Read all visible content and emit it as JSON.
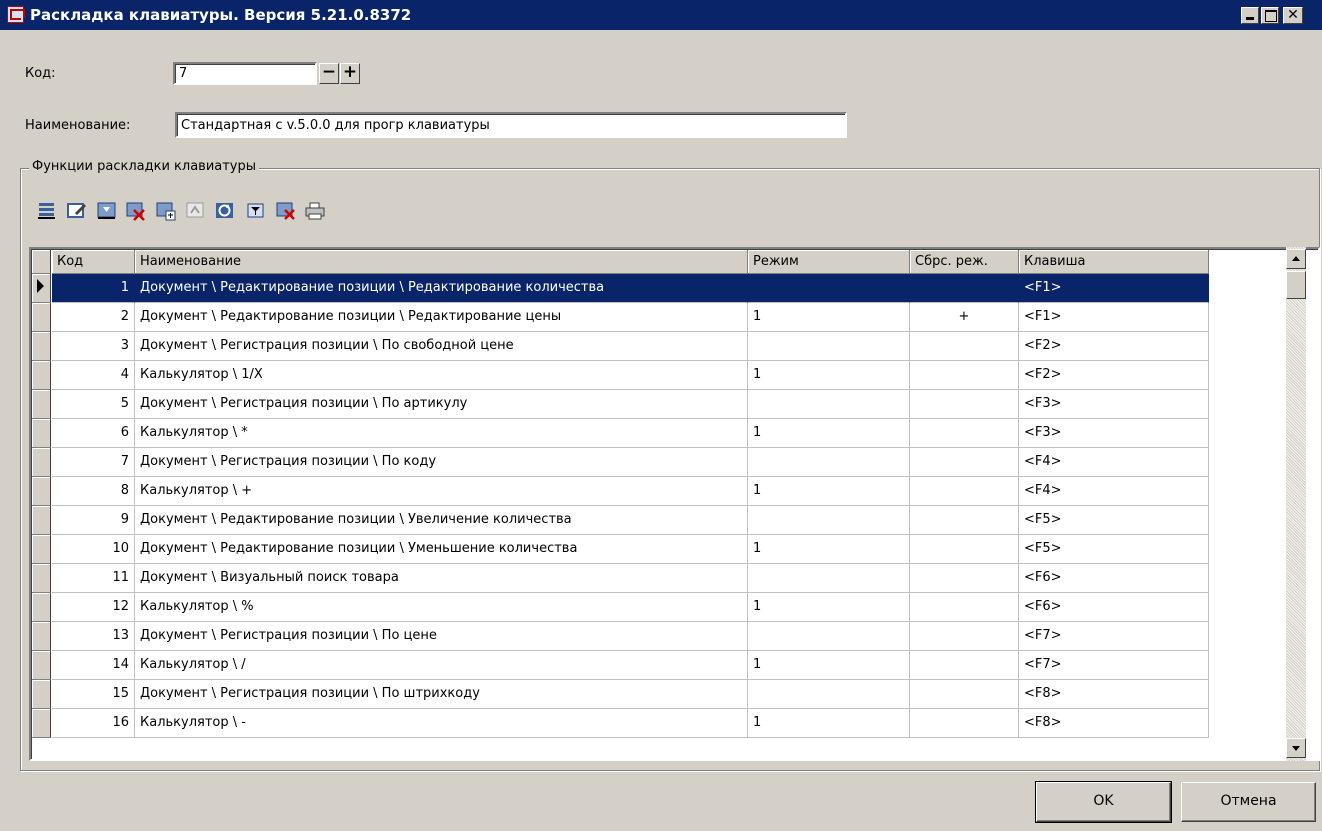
{
  "window": {
    "title": "Раскладка клавиатуры. Версия 5.21.0.8372"
  },
  "form": {
    "code_label": "Код:",
    "code_value": "7",
    "name_label": "Наименование:",
    "name_value": "Стандартная с v.5.0.0 для прогр клавиатуры"
  },
  "group": {
    "legend": "Функции раскладки клавиатуры"
  },
  "toolbar": {
    "icons": [
      "add-record-icon",
      "edit-record-icon",
      "insert-record-icon",
      "delete-record-icon",
      "copy-record-icon",
      "import-icon",
      "refresh-icon",
      "filter-icon",
      "clear-filter-icon",
      "print-icon"
    ]
  },
  "grid": {
    "headers": [
      "Код",
      "Наименование",
      "Режим",
      "Сбрс. реж.",
      "Клавиша"
    ],
    "rows": [
      {
        "code": "1",
        "name": "Документ \\ Редактирование позиции \\ Редактирование количества",
        "mode": "",
        "reset": "",
        "key": "<F1>"
      },
      {
        "code": "2",
        "name": "Документ \\ Редактирование позиции \\ Редактирование цены",
        "mode": "1",
        "reset": "+",
        "key": "<F1>"
      },
      {
        "code": "3",
        "name": "Документ \\ Регистрация позиции \\ По свободной цене",
        "mode": "",
        "reset": "",
        "key": "<F2>"
      },
      {
        "code": "4",
        "name": "Калькулятор \\ 1/X",
        "mode": "1",
        "reset": "",
        "key": "<F2>"
      },
      {
        "code": "5",
        "name": "Документ \\ Регистрация позиции \\ По артикулу",
        "mode": "",
        "reset": "",
        "key": "<F3>"
      },
      {
        "code": "6",
        "name": "Калькулятор \\ *",
        "mode": "1",
        "reset": "",
        "key": "<F3>"
      },
      {
        "code": "7",
        "name": "Документ \\ Регистрация позиции \\ По коду",
        "mode": "",
        "reset": "",
        "key": "<F4>"
      },
      {
        "code": "8",
        "name": "Калькулятор \\ +",
        "mode": "1",
        "reset": "",
        "key": "<F4>"
      },
      {
        "code": "9",
        "name": "Документ \\ Редактирование позиции \\ Увеличение количества",
        "mode": "",
        "reset": "",
        "key": "<F5>"
      },
      {
        "code": "10",
        "name": "Документ \\ Редактирование позиции \\ Уменьшение количества",
        "mode": "1",
        "reset": "",
        "key": "<F5>"
      },
      {
        "code": "11",
        "name": "Документ \\ Визуальный поиск товара",
        "mode": "",
        "reset": "",
        "key": "<F6>"
      },
      {
        "code": "12",
        "name": "Калькулятор \\ %",
        "mode": "1",
        "reset": "",
        "key": "<F6>"
      },
      {
        "code": "13",
        "name": "Документ \\ Регистрация позиции \\ По цене",
        "mode": "",
        "reset": "",
        "key": "<F7>"
      },
      {
        "code": "14",
        "name": "Калькулятор \\ /",
        "mode": "1",
        "reset": "",
        "key": "<F7>"
      },
      {
        "code": "15",
        "name": "Документ \\ Регистрация позиции \\ По штрихкоду",
        "mode": "",
        "reset": "",
        "key": "<F8>"
      },
      {
        "code": "16",
        "name": "Калькулятор \\ -",
        "mode": "1",
        "reset": "",
        "key": "<F8>"
      }
    ]
  },
  "buttons": {
    "ok": "OK",
    "cancel": "Отмена"
  },
  "colors": {
    "titlebar": "#0a246a",
    "selection": "#0a246a",
    "face": "#d4d0c8"
  }
}
